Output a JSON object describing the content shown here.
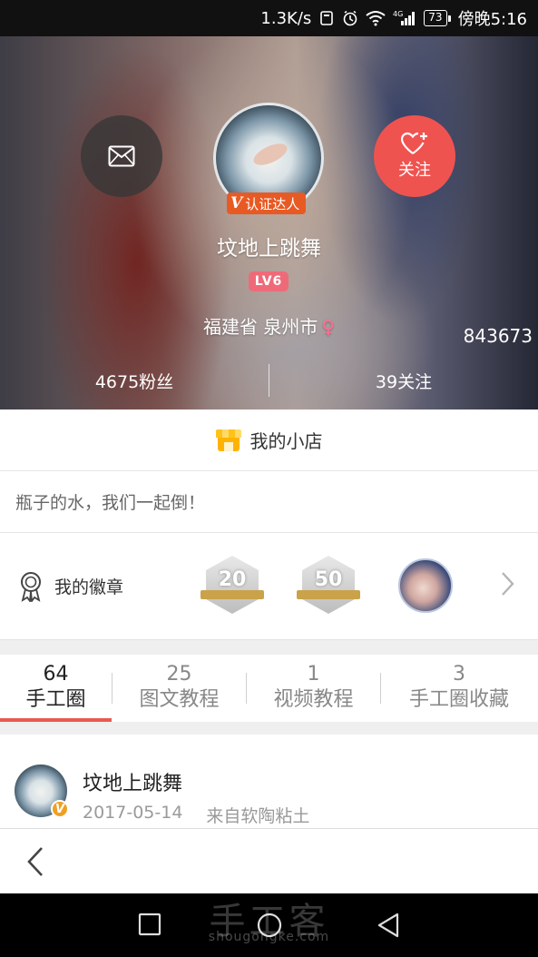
{
  "status_bar": {
    "speed": "1.3K/s",
    "network": "4G",
    "battery": "73",
    "time": "傍晚5:16",
    "icons": [
      "alarm-icon",
      "clock-icon",
      "wifi-icon",
      "signal-icon",
      "battery-icon"
    ]
  },
  "profile": {
    "username": "坟地上跳舞",
    "verify_badge": "认证达人",
    "verify_mark": "V",
    "level": "LV6",
    "location": "福建省 泉州市",
    "gender_symbol": "♀",
    "side_number": "843673",
    "fans": "4675粉丝",
    "following": "39关注",
    "follow_label": "关注",
    "colors": {
      "follow": "#ef5350",
      "level": "#ef6a78",
      "verify": "#e85a24"
    }
  },
  "shop": {
    "label": "我的小店",
    "icon": "shop-icon"
  },
  "motto": "瓶子的水，我们一起倒！",
  "badges": {
    "label": "我的徽章",
    "items": [
      {
        "type": "hex",
        "value": "20"
      },
      {
        "type": "hex",
        "value": "50"
      },
      {
        "type": "photo"
      }
    ]
  },
  "tabs": [
    {
      "count": "64",
      "name": "手工圈",
      "active": true
    },
    {
      "count": "25",
      "name": "图文教程",
      "active": false
    },
    {
      "count": "1",
      "name": "视频教程",
      "active": false
    },
    {
      "count": "3",
      "name": "手工圈收藏",
      "active": false
    }
  ],
  "post": {
    "author": "坟地上跳舞",
    "date": "2017-05-14",
    "source": "来自软陶粘土",
    "avatar_mark": "V"
  },
  "watermark": {
    "main": "手工客",
    "sub": "shougongke.com"
  }
}
